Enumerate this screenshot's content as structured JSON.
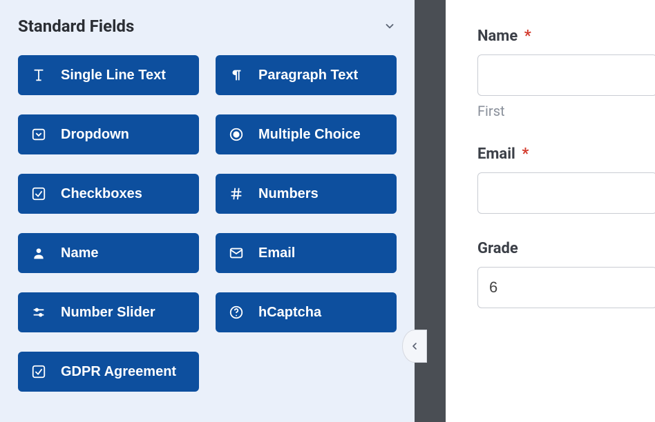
{
  "sidebar": {
    "section_title": "Standard Fields",
    "fields": [
      {
        "label": "Single Line Text"
      },
      {
        "label": "Paragraph Text"
      },
      {
        "label": "Dropdown"
      },
      {
        "label": "Multiple Choice"
      },
      {
        "label": "Checkboxes"
      },
      {
        "label": "Numbers"
      },
      {
        "label": "Name"
      },
      {
        "label": "Email"
      },
      {
        "label": "Number Slider"
      },
      {
        "label": "hCaptcha"
      },
      {
        "label": "GDPR Agreement"
      }
    ]
  },
  "preview": {
    "name": {
      "label": "Name",
      "required_mark": "*",
      "sublabel": "First",
      "value": ""
    },
    "email": {
      "label": "Email",
      "required_mark": "*",
      "value": ""
    },
    "grade": {
      "label": "Grade",
      "value": "6"
    }
  }
}
